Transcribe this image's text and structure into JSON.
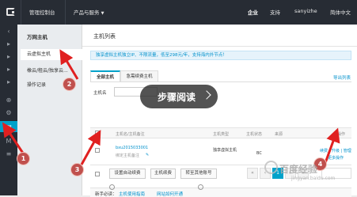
{
  "topbar": {
    "console": "管理控制台",
    "products": "产品与服务",
    "enterprise": "企业",
    "support": "支持",
    "user": "sanyizhe",
    "language": "简体中文"
  },
  "subnav": {
    "title": "万网主机",
    "items": [
      {
        "label": "云虚拟主机"
      },
      {
        "label": "橡云/租云/独享云..."
      },
      {
        "label": "操作记录"
      }
    ]
  },
  "main": {
    "page_title": "主机列表",
    "notice": "独享虚拟主机独立IP、不限流量，低至298元/年，支持海内外节点！",
    "tabs": [
      {
        "label": "全部主机"
      },
      {
        "label": "急需续费主机"
      }
    ],
    "export": "导出列表",
    "filter_label": "主机名",
    "columns": [
      "主机名/主机备注",
      "主机类型",
      "主机状态",
      "来源",
      "操作"
    ],
    "rows": [
      {
        "name": "bxu2015033001",
        "note": "绑定主机备注",
        "type": "独享虚拟主机",
        "state": "BC",
        "actions": "续费 | 升级 | 管理",
        "more": "更多操作"
      }
    ],
    "buttons": [
      "设置自动续费",
      "主机续费",
      "转至其他账号"
    ],
    "pager": {
      "prev2": "«",
      "prev": "‹",
      "current": "1",
      "next": "›",
      "next2": "»"
    },
    "newbie": {
      "label": "新手必读：",
      "link1": "主机使用指南",
      "link2": "网站如何开通"
    }
  },
  "overlay": {
    "label": "步骤阅读"
  },
  "markers": [
    "1",
    "2",
    "3",
    "4"
  ],
  "watermark": {
    "text": "百度经验",
    "url": "jingyan.baidu.com"
  },
  "colors": {
    "accent": "#00a2ca",
    "topbar": "#272c34",
    "marker": "#c0504d",
    "arrow": "#e02020"
  }
}
